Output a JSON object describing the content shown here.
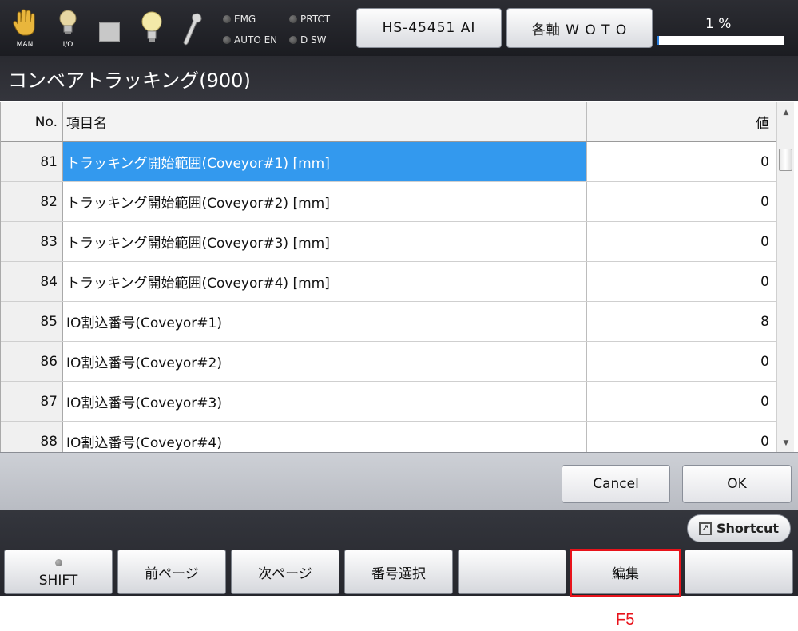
{
  "topbar": {
    "icons": [
      {
        "name": "hand-icon",
        "label": "MAN"
      },
      {
        "name": "io-bulb-icon",
        "label": "I/O"
      },
      {
        "name": "stop-square-icon",
        "label": ""
      },
      {
        "name": "lightbulb-icon",
        "label": ""
      },
      {
        "name": "wrench-icon",
        "label": ""
      }
    ],
    "indicators": {
      "emg": "EMG",
      "prtct": "PRTCT",
      "auto_en": "AUTO EN",
      "d_sw": "D SW"
    },
    "robot_button": "HS-45451 AI",
    "axis_button": "各軸 W O T O",
    "percent_text": "1 %",
    "progress_percent": 1,
    "accent_color": "#2a7fe0"
  },
  "title": "コンベアトラッキング(900)",
  "table": {
    "headers": {
      "no": "No.",
      "name": "項目名",
      "value": "値"
    },
    "rows": [
      {
        "no": "81",
        "name": "トラッキング開始範囲(Coveyor#1) [mm]",
        "value": "0"
      },
      {
        "no": "82",
        "name": "トラッキング開始範囲(Coveyor#2) [mm]",
        "value": "0"
      },
      {
        "no": "83",
        "name": "トラッキング開始範囲(Coveyor#3) [mm]",
        "value": "0"
      },
      {
        "no": "84",
        "name": "トラッキング開始範囲(Coveyor#4) [mm]",
        "value": "0"
      },
      {
        "no": "85",
        "name": "IO割込番号(Coveyor#1)",
        "value": "8"
      },
      {
        "no": "86",
        "name": "IO割込番号(Coveyor#2)",
        "value": "0"
      },
      {
        "no": "87",
        "name": "IO割込番号(Coveyor#3)",
        "value": "0"
      },
      {
        "no": "88",
        "name": "IO割込番号(Coveyor#4)",
        "value": "0"
      }
    ],
    "selected_index": 0,
    "selection_color": "#3399ee"
  },
  "dialog": {
    "cancel": "Cancel",
    "ok": "OK"
  },
  "bottombar": {
    "shortcut": "Shortcut",
    "fkeys": [
      {
        "label": "SHIFT"
      },
      {
        "label": "前ページ"
      },
      {
        "label": "次ページ"
      },
      {
        "label": "番号選択"
      },
      {
        "label": ""
      },
      {
        "label": "編集"
      },
      {
        "label": ""
      }
    ]
  },
  "annotation": {
    "label": "F5",
    "color": "#e8131b"
  }
}
